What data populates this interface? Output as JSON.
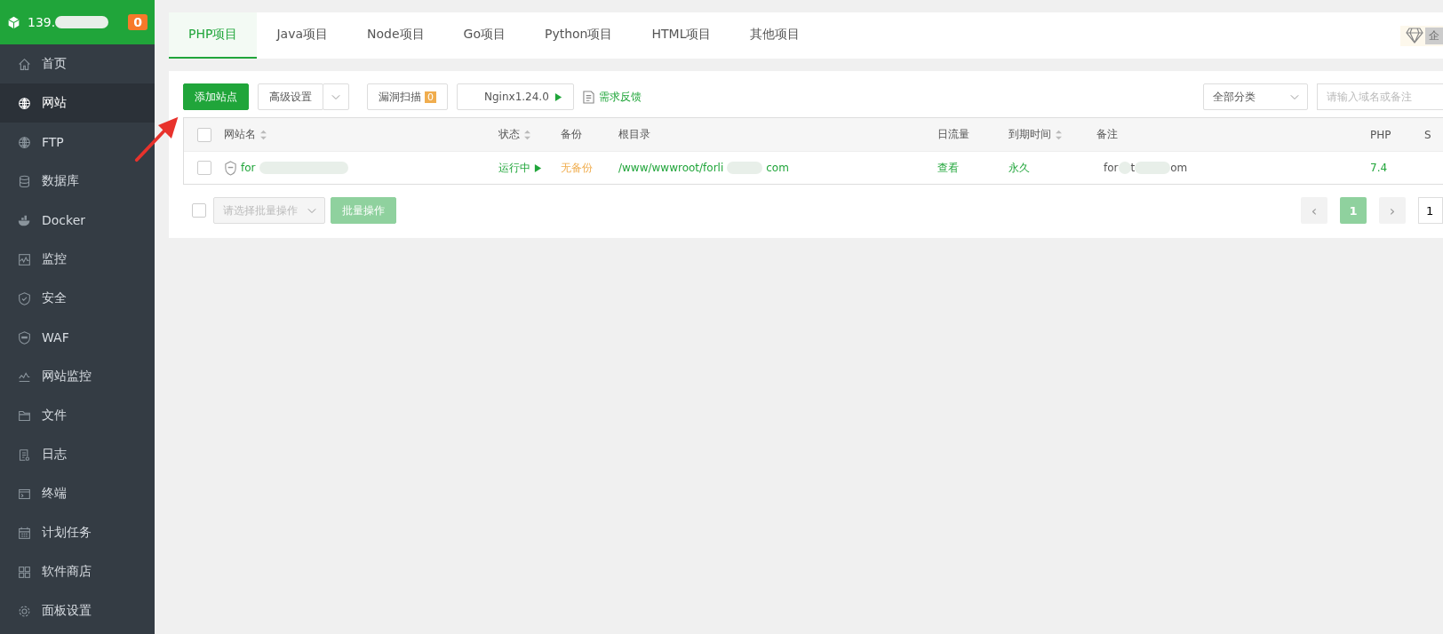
{
  "sidebar": {
    "header": {
      "ip": "139.",
      "badge": "0"
    },
    "items": [
      {
        "label": "首页",
        "selected": false
      },
      {
        "label": "网站",
        "selected": true
      },
      {
        "label": "FTP",
        "selected": false
      },
      {
        "label": "数据库",
        "selected": false
      },
      {
        "label": "Docker",
        "selected": false
      },
      {
        "label": "监控",
        "selected": false
      },
      {
        "label": "安全",
        "selected": false
      },
      {
        "label": "WAF",
        "selected": false
      },
      {
        "label": "网站监控",
        "selected": false
      },
      {
        "label": "文件",
        "selected": false
      },
      {
        "label": "日志",
        "selected": false
      },
      {
        "label": "终端",
        "selected": false
      },
      {
        "label": "计划任务",
        "selected": false
      },
      {
        "label": "软件商店",
        "selected": false
      },
      {
        "label": "面板设置",
        "selected": false
      }
    ]
  },
  "tabs": [
    {
      "label": "PHP项目",
      "selected": true
    },
    {
      "label": "Java项目",
      "selected": false
    },
    {
      "label": "Node项目",
      "selected": false
    },
    {
      "label": "Go项目",
      "selected": false
    },
    {
      "label": "Python项目",
      "selected": false
    },
    {
      "label": "HTML项目",
      "selected": false
    },
    {
      "label": "其他项目",
      "selected": false
    }
  ],
  "edition_badge": "企",
  "toolbar": {
    "add_site": "添加站点",
    "advanced": "高级设置",
    "scan": "漏洞扫描",
    "scan_count": "0",
    "nginx": "Nginx1.24.0",
    "feedback": "需求反馈",
    "category": "全部分类",
    "search": {
      "placeholder": "请输入域名或备注"
    }
  },
  "table": {
    "header_checked": false,
    "columns": [
      {
        "label": "网站名",
        "sortable": true
      },
      {
        "label": "状态",
        "sortable": true
      },
      {
        "label": "备份",
        "sortable": false
      },
      {
        "label": "根目录",
        "sortable": false
      },
      {
        "label": "日流量",
        "sortable": false
      },
      {
        "label": "到期时间",
        "sortable": true
      },
      {
        "label": "备注",
        "sortable": false
      },
      {
        "label": "PHP",
        "sortable": false
      },
      {
        "label": "S",
        "sortable": false
      }
    ],
    "rows": [
      {
        "checked": false,
        "name": "for",
        "status": "运行中",
        "backup": "无备份",
        "root_start": "/www/wwwroot/forli",
        "root_end": "com",
        "traffic": "查看",
        "expire": "永久",
        "remark_start": "for",
        "remark_mid": "t",
        "remark_end": "om",
        "php": "7.4"
      }
    ]
  },
  "footer": {
    "checked": false,
    "batch_select": {
      "placeholder": "请选择批量操作"
    },
    "batch_button": "批量操作"
  },
  "pagination": {
    "prev": "‹",
    "pages": [
      {
        "label": "1",
        "selected": true
      }
    ],
    "next": "›",
    "page_input": "1"
  }
}
